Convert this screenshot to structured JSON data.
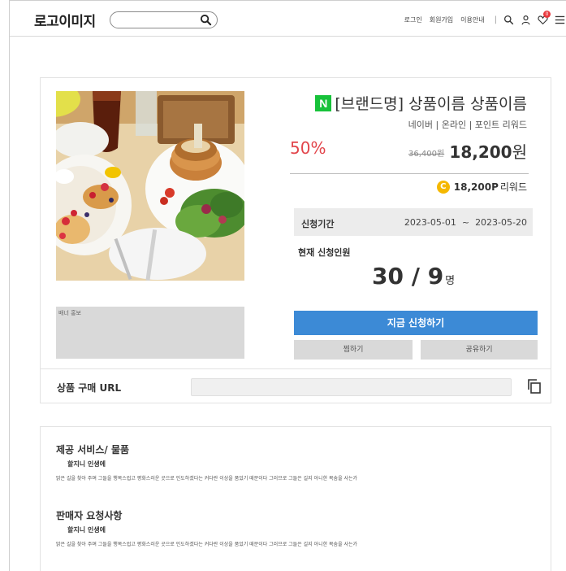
{
  "header": {
    "logo": "로고이미지",
    "nav": {
      "login": "로그인",
      "signup": "회원가입",
      "guide": "이용안내"
    },
    "wish_count": "0"
  },
  "product": {
    "naver_mark": "N",
    "title": "[브랜드명] 상품이름 상품이름",
    "subtitle": "네이버 | 온라인 | 포인트 리워드",
    "discount": "50%",
    "original_price": "36,400원",
    "price": "18,200",
    "price_unit": "원",
    "reward_coin": "C",
    "reward_amount": "18,200P",
    "reward_label": "리워드",
    "banner_label": "배너 홍보"
  },
  "period": {
    "label": "신청기간",
    "start": "2023-05-01",
    "separator": "~",
    "end": "2023-05-20"
  },
  "applicants": {
    "label": "현재 신청인원",
    "value": "30 / 9",
    "unit": "명"
  },
  "buttons": {
    "apply": "지금 신청하기",
    "wish": "찜하기",
    "share": "공유하기"
  },
  "url_row": {
    "label": "상품 구매 URL",
    "value": ""
  },
  "info": {
    "sections": [
      {
        "title": "제공 서비스/ 물품",
        "subtitle": "할지니 인생에",
        "body": "밝은 길을 찾아 주며 그들을 행복스럽고 평화스러운 곳으로 인도하겠다는 커다란 이상을 품었기 때문이다 그러므로 그들은 길지 아니한 목숨을 사는가"
      },
      {
        "title": "판매자 요청사항",
        "subtitle": "할지니 인생에",
        "body": "밝은 길을 찾아 주며 그들을 행복스럽고 평화스러운 곳으로 인도하겠다는 커다란 이상을 품었기 때문이다 그러므로 그들은 길지 아니한 목숨을 사는가"
      }
    ]
  },
  "colors": {
    "accent_blue": "#3c8ad6",
    "discount_red": "#e2454b",
    "naver_green": "#17c23a",
    "coin_yellow": "#f5b800"
  }
}
